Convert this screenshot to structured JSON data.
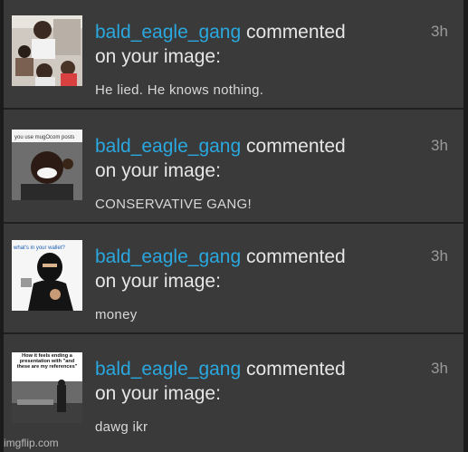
{
  "notifications": [
    {
      "user": "bald_eagle_gang",
      "verb": "commented",
      "object": "on your image:",
      "comment": "He lied. He knows nothing.",
      "time": "3h",
      "thumbnail": "meme-thumbnail-1"
    },
    {
      "user": "bald_eagle_gang",
      "verb": "commented",
      "object": "on your image:",
      "comment": "CONSERVATIVE GANG!",
      "time": "3h",
      "thumbnail": "meme-thumbnail-2",
      "thumbnail_caption": "you use mugOcom posts"
    },
    {
      "user": "bald_eagle_gang",
      "verb": "commented",
      "object": "on your image:",
      "comment": "money",
      "time": "3h",
      "thumbnail": "meme-thumbnail-3",
      "thumbnail_caption": "what's in your wallet?"
    },
    {
      "user": "bald_eagle_gang",
      "verb": "commented",
      "object": "on your image:",
      "comment": "dawg ikr",
      "time": "3h",
      "thumbnail": "meme-thumbnail-4",
      "thumbnail_caption": "How it feels ending a presentation with \"and these are my references\""
    }
  ],
  "watermark": "imgflip.com",
  "colors": {
    "background": "#3a3a3a",
    "username": "#2aa8e0",
    "text": "#e6e6e6",
    "time": "#9a9a9a",
    "divider": "#202020"
  }
}
